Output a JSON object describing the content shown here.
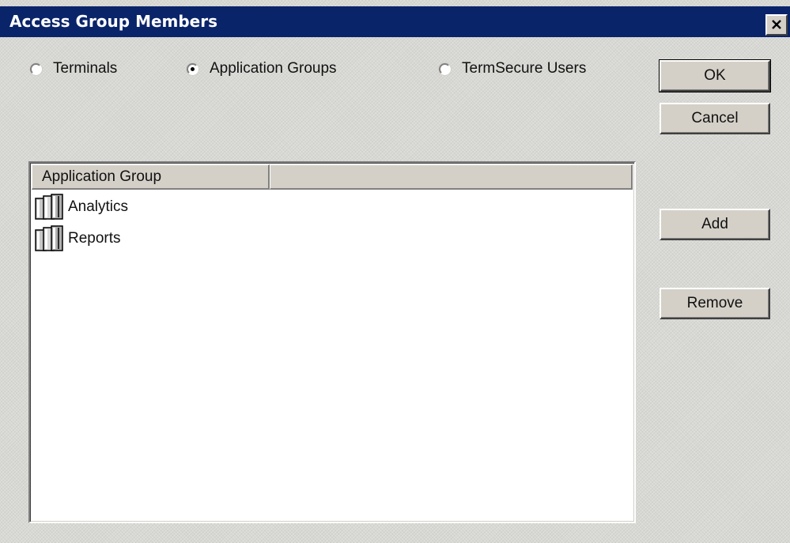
{
  "window": {
    "title": "Access Group Members",
    "close_glyph": "✕"
  },
  "radios": [
    {
      "label": "Terminals",
      "selected": false
    },
    {
      "label": "Application Groups",
      "selected": true
    },
    {
      "label": "TermSecure Users",
      "selected": false
    }
  ],
  "buttons": {
    "ok": "OK",
    "cancel": "Cancel",
    "add": "Add",
    "remove": "Remove"
  },
  "list": {
    "columns": [
      "Application Group",
      ""
    ],
    "rows": [
      {
        "label": "Analytics",
        "icon": "server-group-icon"
      },
      {
        "label": "Reports",
        "icon": "server-group-icon"
      }
    ]
  },
  "colors": {
    "title_bar": "#0a246a",
    "dialog_bg": "#d4d0c8"
  }
}
